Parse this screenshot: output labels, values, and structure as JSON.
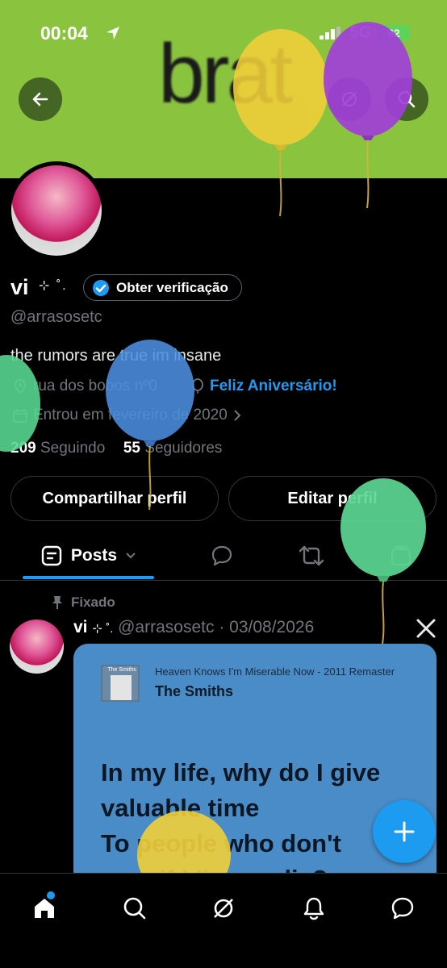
{
  "status_bar": {
    "time": "00:04",
    "network": "5G",
    "battery": "62"
  },
  "banner": {
    "text": "brat",
    "color": "#8ac43f"
  },
  "profile": {
    "display_name": "vi",
    "name_decoration": "⊹ ˚.",
    "verify_label": "Obter verificação",
    "handle": "@arrasosetc",
    "bio": "the rumors are true im insane",
    "location": "rua dos bobos nº0",
    "birthday": "Feliz Aniversário!",
    "joined": "Entrou em fevereiro de 2020",
    "following_count": "209",
    "following_label": "Seguindo",
    "followers_count": "55",
    "followers_label": "Seguidores",
    "share_button": "Compartilhar perfil",
    "edit_button": "Editar perfil"
  },
  "tabs": {
    "posts_label": "Posts"
  },
  "pinned_post": {
    "pinned_label": "Fixado",
    "author_name": "vi",
    "author_decoration": "⊹ ˚.",
    "author_handle": "@arrasosetc",
    "date": "03/08/2026",
    "card": {
      "album_text": "The Smiths",
      "song_title": "Heaven Knows I'm Miserable Now - 2011 Remaster",
      "artist": "The Smiths",
      "lyrics_line1": "In my life, why do I give",
      "lyrics_line2": "valuable time",
      "lyrics_line3": "To people who don't",
      "lyrics_line4": "care if I live or die?"
    }
  },
  "colors": {
    "accent": "#1d9bf0",
    "background": "#000000",
    "card": "#4a8cc7"
  },
  "icons": [
    "back-arrow-icon",
    "grok-icon",
    "search-icon",
    "verified-badge-icon",
    "location-icon",
    "balloon-icon",
    "calendar-icon",
    "chevron-right-icon",
    "chevron-down-icon",
    "reply-icon",
    "retweet-icon",
    "media-icon",
    "pin-icon",
    "x-logo-icon",
    "plus-icon",
    "home-icon",
    "notifications-icon",
    "messages-icon"
  ]
}
